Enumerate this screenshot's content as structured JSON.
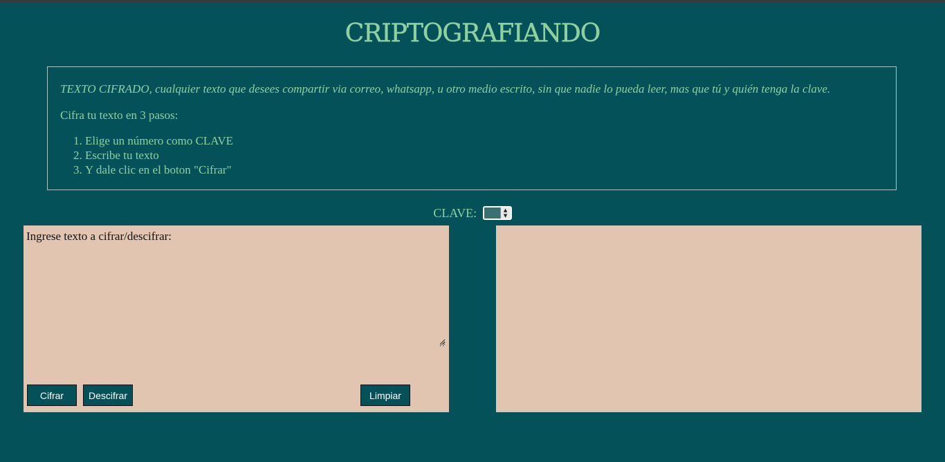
{
  "page": {
    "title": "CRIPTOGRAFIANDO"
  },
  "info": {
    "intro": "TEXTO CIFRADO, cualquier texto que desees compartir via correo, whatsapp, u otro medio escrito, sin que nadie lo pueda leer, mas que tú y quién tenga la clave.",
    "steps_title": "Cifra tu texto en 3 pasos:",
    "steps": [
      "Elige un número como CLAVE",
      "Escribe tu texto",
      "Y dale clic en el boton \"Cifrar\""
    ]
  },
  "clave": {
    "label": "CLAVE:",
    "value": ""
  },
  "input_panel": {
    "placeholder": "Ingrese texto a cifrar/descifrar:",
    "value": "",
    "cifrar_label": "Cifrar",
    "descifrar_label": "Descifrar",
    "limpiar_label": "Limpiar"
  },
  "output_panel": {
    "value": ""
  },
  "colors": {
    "background": "#055159",
    "accent_text": "#8fd19e",
    "panel": "#e2c5b0",
    "button": "#055159"
  }
}
